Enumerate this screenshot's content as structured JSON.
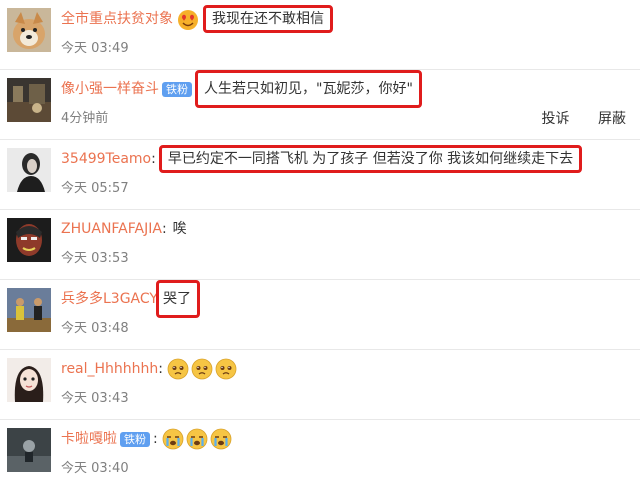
{
  "comments": [
    {
      "user": "全市重点扶贫对象",
      "text": "我现在还不敢相信",
      "time": "今天 03:49",
      "icon": "heart-eyes-emoji-icon"
    },
    {
      "user": "像小强一样奋斗",
      "badge": "铁粉",
      "text": "人生若只如初见，\"瓦妮莎，你好\"",
      "time": "4分钟前",
      "actions": [
        "投诉",
        "屏蔽"
      ]
    },
    {
      "user": "35499Teamo",
      "text": "早已约定不一同搭飞机 为了孩子 但若没了你 我该如何继续走下去",
      "time": "今天 05:57"
    },
    {
      "user": "ZHUANFAFAJIA",
      "text": "唉",
      "time": "今天 03:53"
    },
    {
      "user": "兵多多L3GACY",
      "text": "哭了",
      "time": "今天 03:48"
    },
    {
      "user": "real_Hhhhhhh",
      "text": "",
      "time": "今天 03:43",
      "emojis": [
        "sad-face-emoji-icon",
        "sad-face-emoji-icon",
        "sad-face-emoji-icon"
      ]
    },
    {
      "user": "卡啦嘎啦",
      "badge": "铁粉",
      "text": "",
      "time": "今天 03:40",
      "emojis": [
        "crying-face-emoji-icon",
        "crying-face-emoji-icon",
        "crying-face-emoji-icon"
      ]
    }
  ],
  "colors": {
    "username": "#eb7350",
    "highlight_box": "#e01c1c",
    "badge": "#5f9ff0",
    "time": "#808080"
  }
}
